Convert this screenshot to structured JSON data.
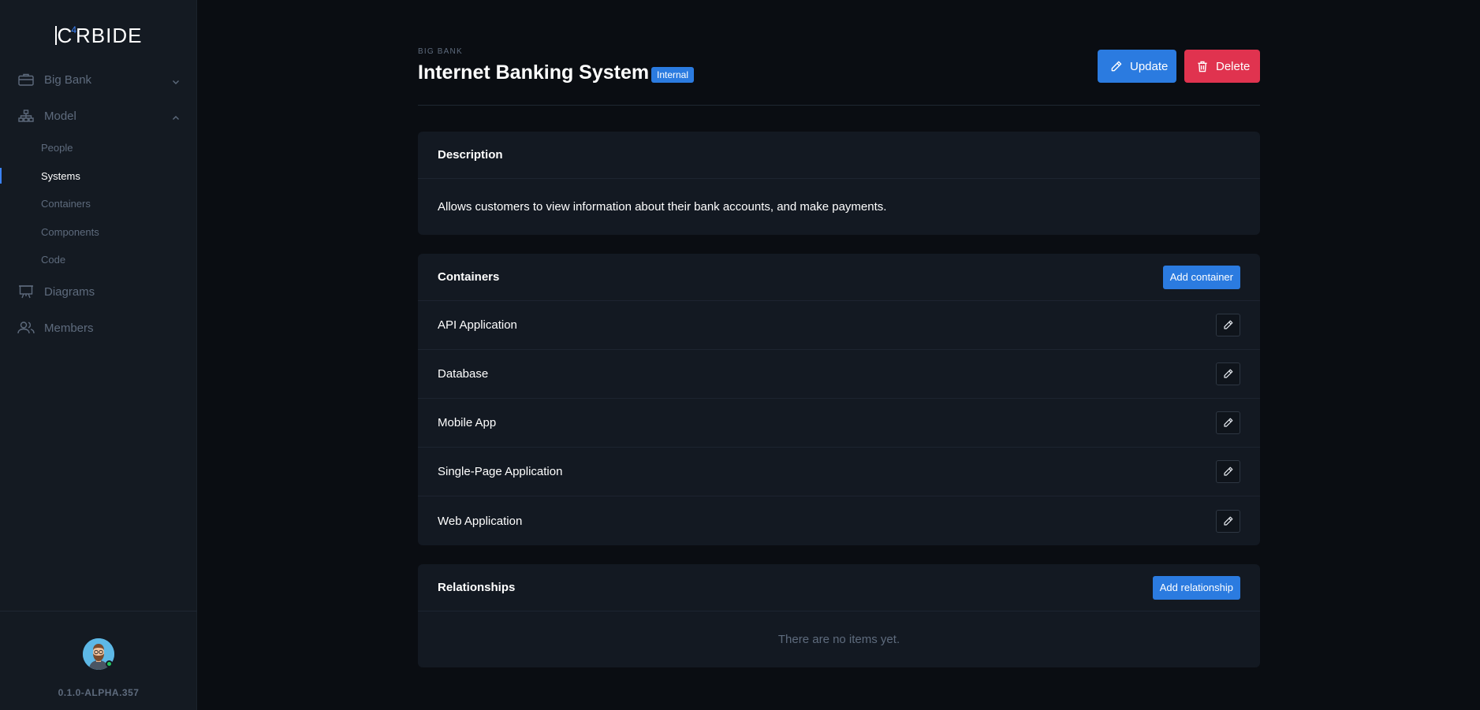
{
  "app": {
    "logo_prefix": "C",
    "logo_sup": "4",
    "logo_suffix": "RBIDE",
    "version": "0.1.0-ALPHA.357"
  },
  "sidebar": {
    "groups": [
      {
        "label": "Big Bank",
        "icon": "briefcase-icon",
        "expanded": false
      },
      {
        "label": "Model",
        "icon": "hierarchy-icon",
        "expanded": true
      },
      {
        "label": "Diagrams",
        "icon": "easel-icon"
      },
      {
        "label": "Members",
        "icon": "users-icon"
      }
    ],
    "model_items": [
      {
        "label": "People",
        "active": false
      },
      {
        "label": "Systems",
        "active": true
      },
      {
        "label": "Containers",
        "active": false
      },
      {
        "label": "Components",
        "active": false
      },
      {
        "label": "Code",
        "active": false
      }
    ]
  },
  "header": {
    "breadcrumb": "BIG BANK",
    "title": "Internet Banking System",
    "badge": "Internal",
    "update_label": "Update",
    "delete_label": "Delete"
  },
  "description": {
    "heading": "Description",
    "text": "Allows customers to view information about their bank accounts, and make payments."
  },
  "containers": {
    "heading": "Containers",
    "add_label": "Add container",
    "items": [
      {
        "name": "API Application"
      },
      {
        "name": "Database"
      },
      {
        "name": "Mobile App"
      },
      {
        "name": "Single-Page Application"
      },
      {
        "name": "Web Application"
      }
    ]
  },
  "relationships": {
    "heading": "Relationships",
    "add_label": "Add relationship",
    "empty_text": "There are no items yet."
  },
  "colors": {
    "accent": "#2b7be0",
    "danger": "#e0334f",
    "online": "#22c55e"
  }
}
